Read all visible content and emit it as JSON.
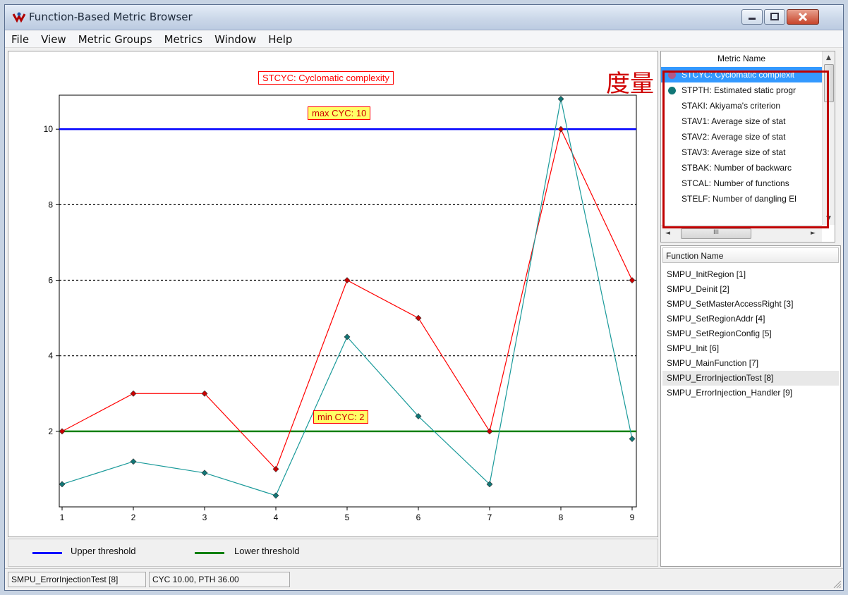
{
  "window": {
    "title": "Function-Based Metric Browser",
    "menu": [
      "File",
      "View",
      "Metric Groups",
      "Metrics",
      "Window",
      "Help"
    ]
  },
  "chart_data": {
    "type": "line",
    "title": "STCYC: Cyclomatic complexity",
    "categories": [
      "1",
      "2",
      "3",
      "4",
      "5",
      "6",
      "7",
      "8",
      "9"
    ],
    "series": [
      {
        "values": [
          2,
          3,
          3,
          1,
          6,
          5,
          2,
          10,
          6
        ],
        "color": "#ff0000",
        "marker": "#cc0000"
      },
      {
        "values": [
          0.6,
          1.2,
          0.9,
          0.3,
          4.5,
          2.4,
          0.6,
          10.8,
          1.8
        ],
        "color": "#1a9a9a",
        "marker": "#117777"
      }
    ],
    "yticks": [
      2,
      4,
      6,
      8,
      10
    ],
    "ylim": [
      0,
      10.9
    ],
    "grid": "dashed at 4, 6, 8",
    "upper_threshold": {
      "value": 10,
      "label": "max CYC: 10",
      "color": "#0000ff"
    },
    "lower_threshold": {
      "value": 2,
      "label": "min CYC: 2",
      "color": "#008000"
    }
  },
  "legend": {
    "upper": {
      "label": "Upper threshold",
      "color": "#0000ff"
    },
    "lower": {
      "label": "Lower threshold",
      "color": "#008000"
    }
  },
  "metrics": {
    "header": "Metric Name",
    "annotation": "度量",
    "items": [
      {
        "label": "STCYC: Cyclomatic complexit",
        "dot": "#b05a8a",
        "selected": true
      },
      {
        "label": "STPTH: Estimated static progr",
        "dot": "#117777",
        "selected": false
      },
      {
        "label": "STAKI: Akiyama's criterion",
        "dot": "",
        "selected": false
      },
      {
        "label": "STAV1: Average size of stat",
        "dot": "",
        "selected": false
      },
      {
        "label": "STAV2: Average size of stat",
        "dot": "",
        "selected": false
      },
      {
        "label": "STAV3: Average size of stat",
        "dot": "",
        "selected": false
      },
      {
        "label": "STBAK: Number of backwarc",
        "dot": "",
        "selected": false
      },
      {
        "label": "STCAL: Number of functions",
        "dot": "",
        "selected": false
      },
      {
        "label": "STELF: Number of dangling El",
        "dot": "",
        "selected": false
      }
    ],
    "hscroll_thumb": "III"
  },
  "functions": {
    "header": "Function Name",
    "items": [
      "SMPU_InitRegion [1]",
      "SMPU_Deinit [2]",
      "SMPU_SetMasterAccessRight [3]",
      "SMPU_SetRegionAddr [4]",
      "SMPU_SetRegionConfig [5]",
      "SMPU_Init [6]",
      "SMPU_MainFunction [7]",
      "SMPU_ErrorInjectionTest [8]",
      "SMPU_ErrorInjection_Handler [9]"
    ],
    "current_index": 7
  },
  "status": {
    "function": "SMPU_ErrorInjectionTest [8]",
    "values": "CYC 10.00, PTH 36.00"
  }
}
